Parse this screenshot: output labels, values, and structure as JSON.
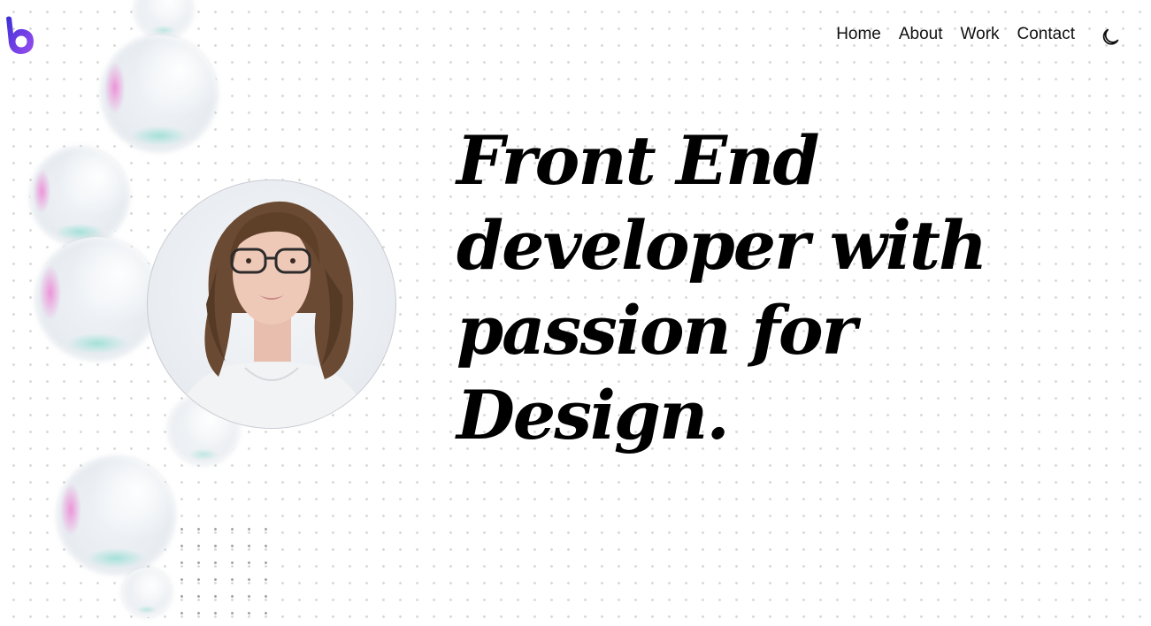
{
  "brand": {
    "logo_icon": "b-logo-icon",
    "accent": "#5b4df2"
  },
  "nav": {
    "items": [
      {
        "label": "Home"
      },
      {
        "label": "About"
      },
      {
        "label": "Work"
      },
      {
        "label": "Contact"
      }
    ]
  },
  "theme_toggle": {
    "icon": "moon-icon"
  },
  "hero": {
    "lines": [
      "Front End",
      "developer with",
      "passion for",
      "Design."
    ]
  }
}
